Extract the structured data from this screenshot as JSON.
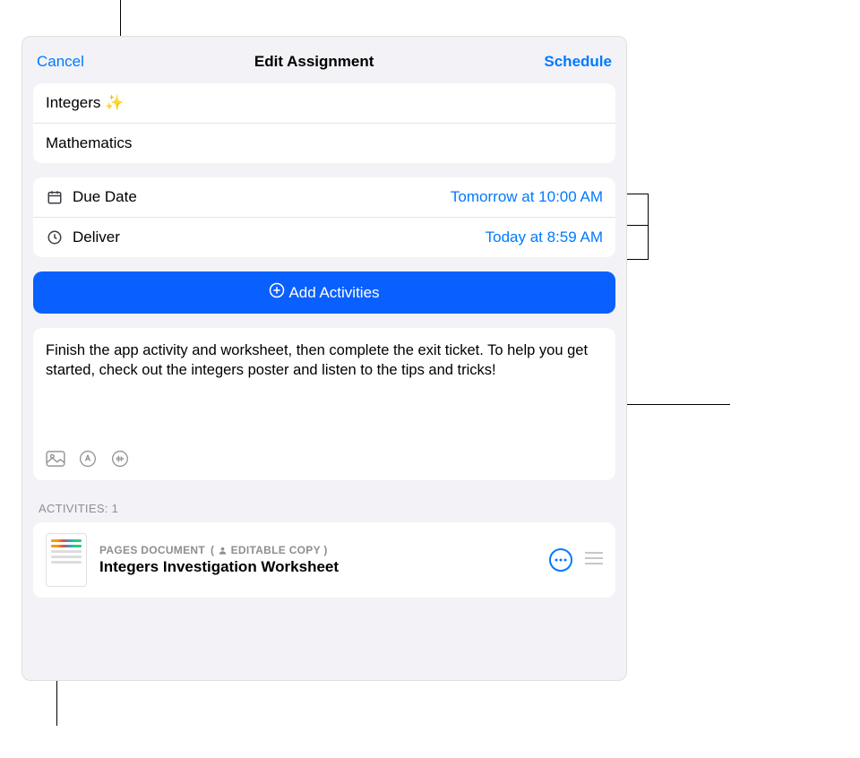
{
  "header": {
    "cancel": "Cancel",
    "title": "Edit Assignment",
    "schedule": "Schedule"
  },
  "assignment": {
    "title": "Integers ✨",
    "class": "Mathematics"
  },
  "dates": {
    "dueLabel": "Due Date",
    "dueValue": "Tomorrow at 10:00 AM",
    "deliverLabel": "Deliver",
    "deliverValue": "Today at 8:59 AM"
  },
  "addActivities": "Add Activities",
  "instructions": "Finish the app activity and worksheet, then complete the exit ticket. To help you get started, check out the integers poster and listen to the tips and tricks!",
  "activitiesHeader": "ACTIVITIES: 1",
  "activities": [
    {
      "type": "PAGES DOCUMENT",
      "badge": "EDITABLE COPY",
      "title": "Integers Investigation Worksheet"
    }
  ]
}
